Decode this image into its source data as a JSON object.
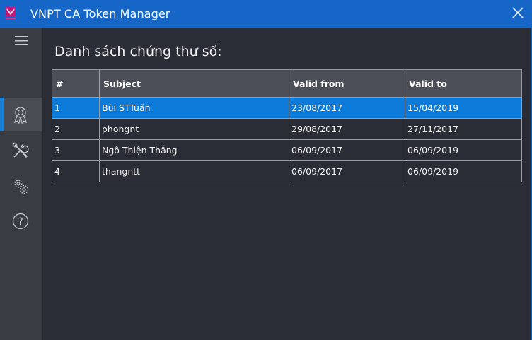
{
  "window": {
    "title": "VNPT CA Token Manager",
    "logo_icon": "vnpt-logo-icon",
    "close_icon": "close-icon"
  },
  "sidebar": {
    "menu_icon": "hamburger-menu-icon",
    "items": [
      {
        "name": "certificates",
        "icon": "certificate-icon",
        "active": true
      },
      {
        "name": "tools",
        "icon": "tools-icon",
        "active": false
      },
      {
        "name": "settings",
        "icon": "settings-gears-icon",
        "active": false
      },
      {
        "name": "help",
        "icon": "help-icon",
        "active": false
      }
    ]
  },
  "main": {
    "heading": "Danh sách chứng thư số:"
  },
  "certificates_table": {
    "columns": [
      "#",
      "Subject",
      "Valid from",
      "Valid to"
    ],
    "rows": [
      {
        "index": "1",
        "subject": "Bùi STTuấn",
        "valid_from": "23/08/2017",
        "valid_to": "15/04/2019",
        "selected": true
      },
      {
        "index": "2",
        "subject": "phongnt",
        "valid_from": "29/08/2017",
        "valid_to": "27/11/2017",
        "selected": false
      },
      {
        "index": "3",
        "subject": "Ngô Thiện Thắng",
        "valid_from": "06/09/2017",
        "valid_to": "06/09/2019",
        "selected": false
      },
      {
        "index": "4",
        "subject": "thangntt",
        "valid_from": "06/09/2017",
        "valid_to": "06/09/2019",
        "selected": false
      }
    ]
  },
  "colors": {
    "titlebar": "#1566c7",
    "sidebar": "#3a3c44",
    "content_background": "#2b2d36",
    "table_header": "#4c4e58",
    "selected_row": "#0b7ad8",
    "logo": "#c0177f"
  }
}
